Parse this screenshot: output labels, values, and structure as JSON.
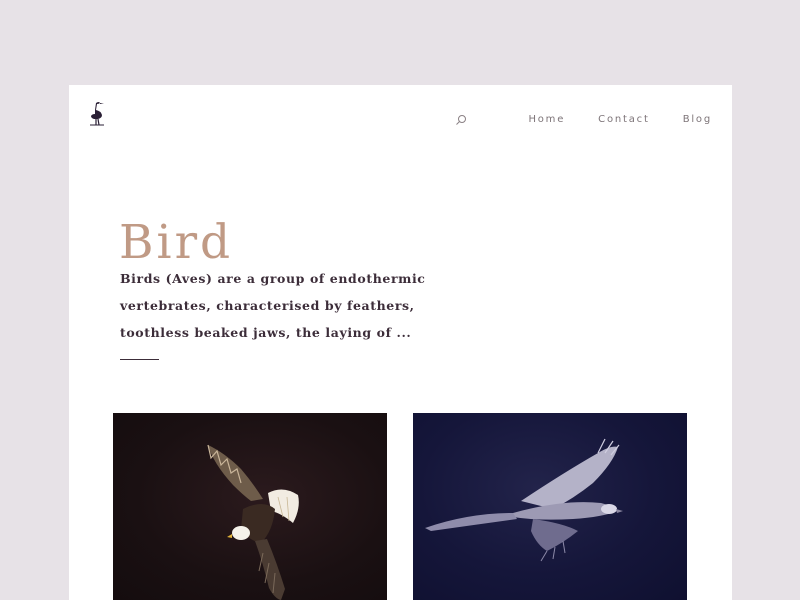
{
  "header": {
    "logo_icon": "heron-logo-icon",
    "search_icon": "search-icon",
    "nav": [
      {
        "label": "Home"
      },
      {
        "label": "Contact"
      },
      {
        "label": "Blog"
      }
    ]
  },
  "hero": {
    "title": "Bird",
    "description": "Birds (Aves) are a group of endothermic vertebrates, characterised by feathers, toothless beaked jaws, the laying of ..."
  },
  "gallery": {
    "images": [
      {
        "subject": "bald eagle flying",
        "bg_color": "#1a1012"
      },
      {
        "subject": "eagle gliding",
        "bg_color": "#15163a"
      }
    ]
  },
  "colors": {
    "background": "#e7e2e7",
    "card": "#ffffff",
    "title": "#c09a85",
    "text": "#3c2d39",
    "nav": "#7d7478"
  }
}
